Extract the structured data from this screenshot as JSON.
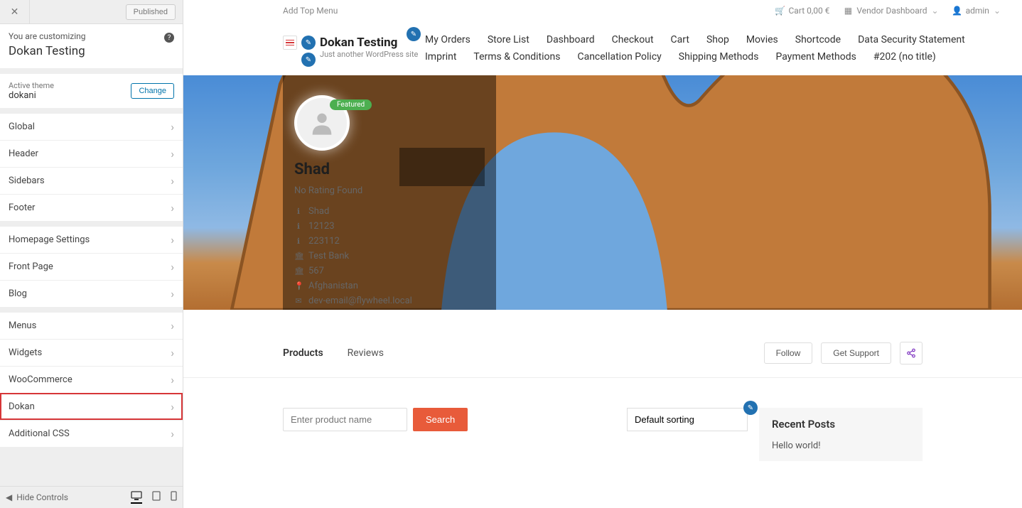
{
  "sidebar": {
    "published_label": "Published",
    "customizing_label": "You are customizing",
    "site_title": "Dokan Testing",
    "active_theme_label": "Active theme",
    "theme_name": "dokani",
    "change_label": "Change",
    "groups": [
      [
        "Global",
        "Header",
        "Sidebars",
        "Footer"
      ],
      [
        "Homepage Settings",
        "Front Page",
        "Blog"
      ],
      [
        "Menus",
        "Widgets",
        "WooCommerce",
        "Dokan",
        "Additional CSS"
      ]
    ],
    "highlight_item": "Dokan",
    "hide_controls_label": "Hide Controls"
  },
  "topbar": {
    "add_top_menu": "Add Top Menu",
    "cart_label": "Cart 0,00 €",
    "vendor_dashboard": "Vendor Dashboard",
    "admin": "admin"
  },
  "brand": {
    "title": "Dokan Testing",
    "tagline": "Just another WordPress site"
  },
  "nav_items": [
    "My Orders",
    "Store List",
    "Dashboard",
    "Checkout",
    "Cart",
    "Shop",
    "Movies",
    "Shortcode",
    "Data Security Statement",
    "Imprint",
    "Terms & Conditions",
    "Cancellation Policy",
    "Shipping Methods",
    "Payment Methods",
    "#202 (no title)"
  ],
  "store": {
    "featured_label": "Featured",
    "name": "Shad",
    "no_rating": "No Rating Found",
    "rows": [
      {
        "icon": "i",
        "text": "Shad"
      },
      {
        "icon": "i",
        "text": "12123"
      },
      {
        "icon": "i",
        "text": "223112"
      },
      {
        "icon": "bank",
        "text": "Test Bank"
      },
      {
        "icon": "bank",
        "text": "567"
      },
      {
        "icon": "pin",
        "text": "Afghanistan"
      },
      {
        "icon": "mail",
        "text": "dev-email@flywheel.local"
      }
    ]
  },
  "tabs": {
    "products": "Products",
    "reviews": "Reviews"
  },
  "actions": {
    "follow": "Follow",
    "support": "Get Support"
  },
  "search": {
    "placeholder": "Enter product name",
    "button": "Search"
  },
  "sort": {
    "value": "Default sorting"
  },
  "recent": {
    "title": "Recent Posts",
    "post": "Hello world!"
  }
}
